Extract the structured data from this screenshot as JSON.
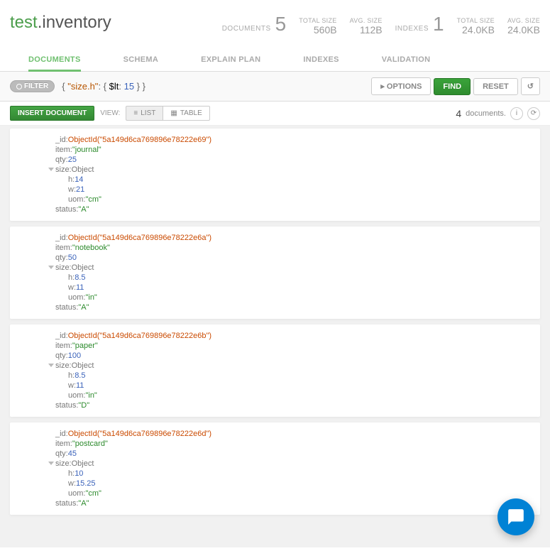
{
  "namespace": {
    "db": "test",
    "sep": ".",
    "collection": "inventory"
  },
  "stats": {
    "documents": {
      "label": "DOCUMENTS",
      "value": "5"
    },
    "totalSize": {
      "label": "TOTAL SIZE",
      "value": "560B"
    },
    "avgSize": {
      "label": "AVG. SIZE",
      "value": "112B"
    },
    "indexes": {
      "label": "INDEXES",
      "value": "1"
    },
    "idxTotalSize": {
      "label": "TOTAL SIZE",
      "value": "24.0KB"
    },
    "idxAvgSize": {
      "label": "AVG. SIZE",
      "value": "24.0KB"
    }
  },
  "tabs": [
    "DOCUMENTS",
    "SCHEMA",
    "EXPLAIN PLAN",
    "INDEXES",
    "VALIDATION"
  ],
  "active_tab": "DOCUMENTS",
  "filter": {
    "badge": "FILTER",
    "query_parts": {
      "k1": "\"size.h\"",
      "op": "$lt",
      "val": "15"
    },
    "options": "OPTIONS",
    "find": "FIND",
    "reset": "RESET"
  },
  "toolbar": {
    "insert": "INSERT DOCUMENT",
    "view_label": "VIEW:",
    "list": "LIST",
    "table": "TABLE",
    "result_count": "4",
    "result_word": "documents."
  },
  "docs": [
    {
      "_id": "ObjectId(\"5a149d6ca769896e78222e69\")",
      "item": "\"journal\"",
      "qty": "25",
      "size": {
        "h": "14",
        "w": "21",
        "uom": "\"cm\""
      },
      "status": "\"A\""
    },
    {
      "_id": "ObjectId(\"5a149d6ca769896e78222e6a\")",
      "item": "\"notebook\"",
      "qty": "50",
      "size": {
        "h": "8.5",
        "w": "11",
        "uom": "\"in\""
      },
      "status": "\"A\""
    },
    {
      "_id": "ObjectId(\"5a149d6ca769896e78222e6b\")",
      "item": "\"paper\"",
      "qty": "100",
      "size": {
        "h": "8.5",
        "w": "11",
        "uom": "\"in\""
      },
      "status": "\"D\""
    },
    {
      "_id": "ObjectId(\"5a149d6ca769896e78222e6d\")",
      "item": "\"postcard\"",
      "qty": "45",
      "size": {
        "h": "10",
        "w": "15.25",
        "uom": "\"cm\""
      },
      "status": "\"A\""
    }
  ]
}
